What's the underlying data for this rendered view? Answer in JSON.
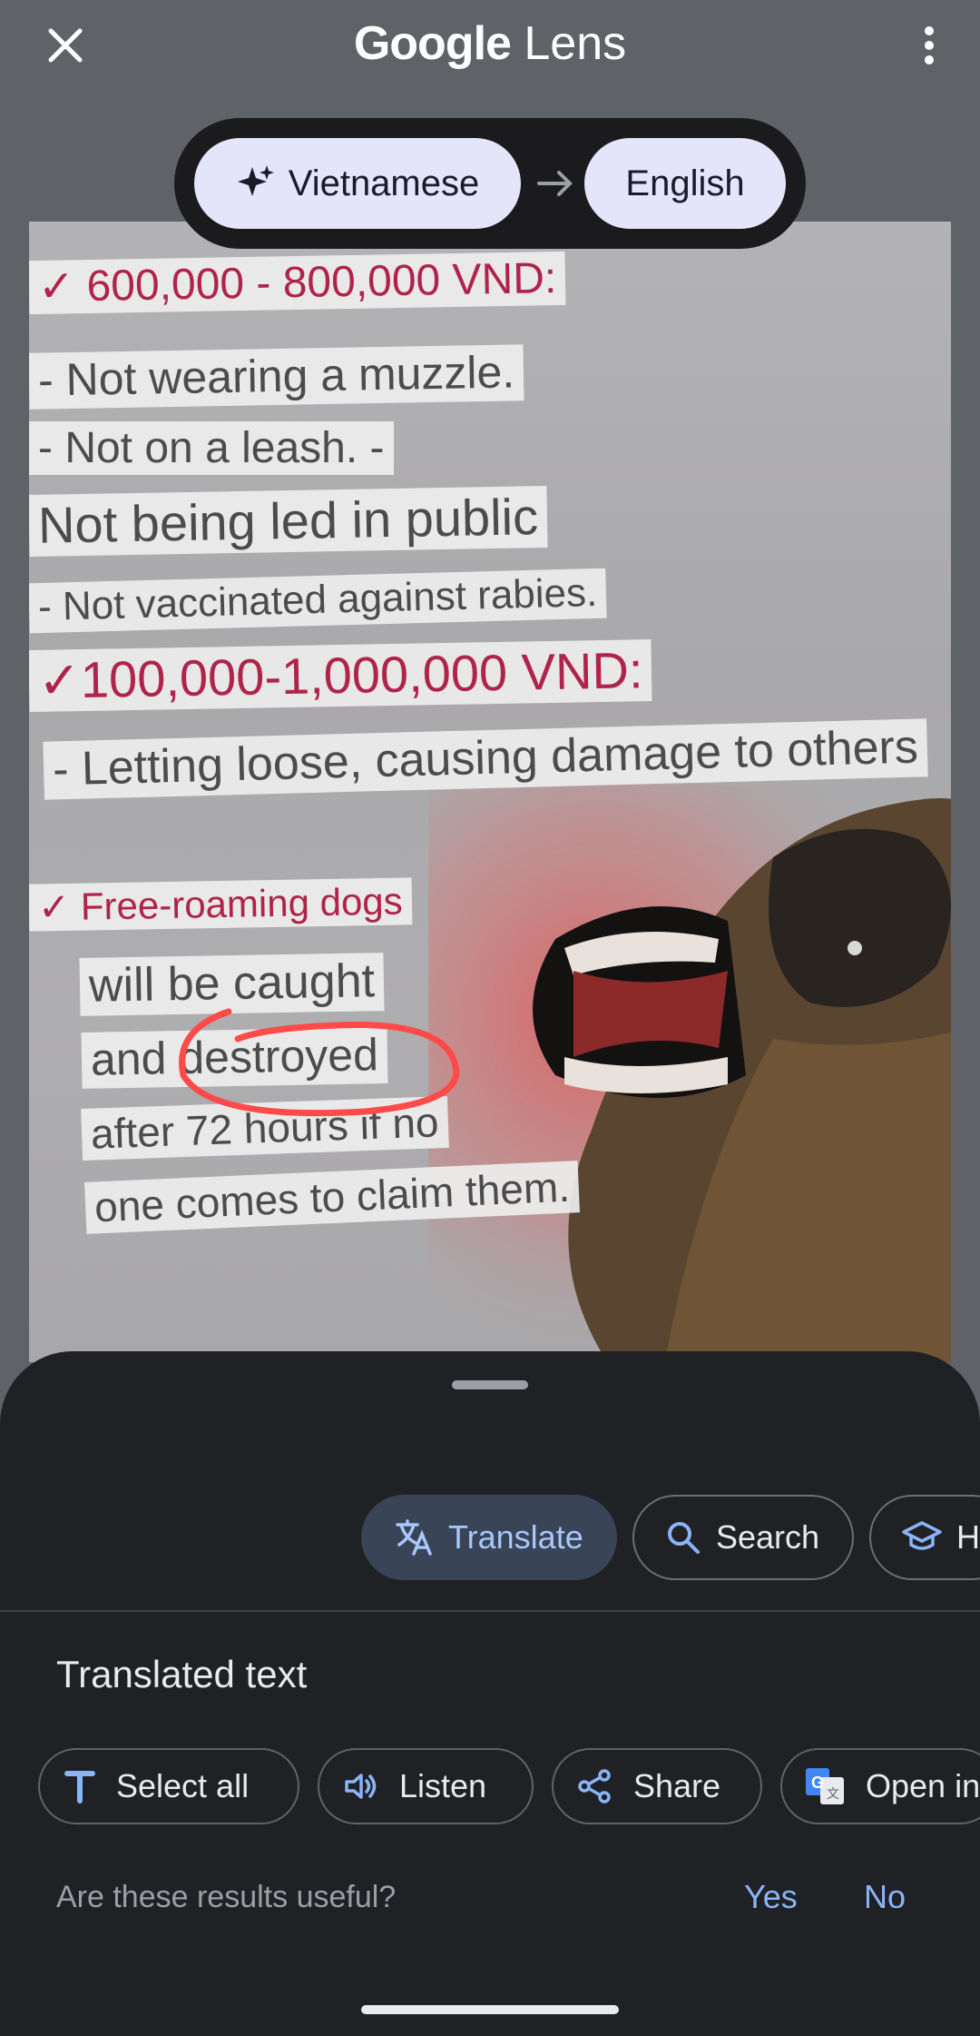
{
  "header": {
    "title_brand": "Google",
    "title_product": "Lens"
  },
  "languages": {
    "source": "Vietnamese",
    "target": "English"
  },
  "photo_text": {
    "line1": "✓ 600,000 - 800,000 VND:",
    "line2": "- Not wearing a muzzle.",
    "line3": "- Not on a leash. -",
    "line4": "Not being led in public",
    "line5": "- Not vaccinated against rabies.",
    "line6": "✓100,000-1,000,000 VND:",
    "line7": "- Letting loose, causing damage to others",
    "line8": "✓ Free-roaming dogs",
    "line9": "will be caught",
    "line10": "and destroyed",
    "line11": "after 72 hours if no",
    "line12": "one comes to claim them."
  },
  "modes": [
    {
      "label": "Translate",
      "active": true
    },
    {
      "label": "Search",
      "active": false
    },
    {
      "label": "Ho",
      "active": false
    }
  ],
  "result": {
    "title": "Translated text",
    "actions": [
      "Select all",
      "Listen",
      "Share",
      "Open in"
    ]
  },
  "feedback": {
    "question": "Are these results useful?",
    "yes": "Yes",
    "no": "No"
  },
  "colors": {
    "accent": "#8ab4f8",
    "sheet_bg": "#202124",
    "pill_bg": "#e4e5fa",
    "red_text": "#b0234a"
  }
}
